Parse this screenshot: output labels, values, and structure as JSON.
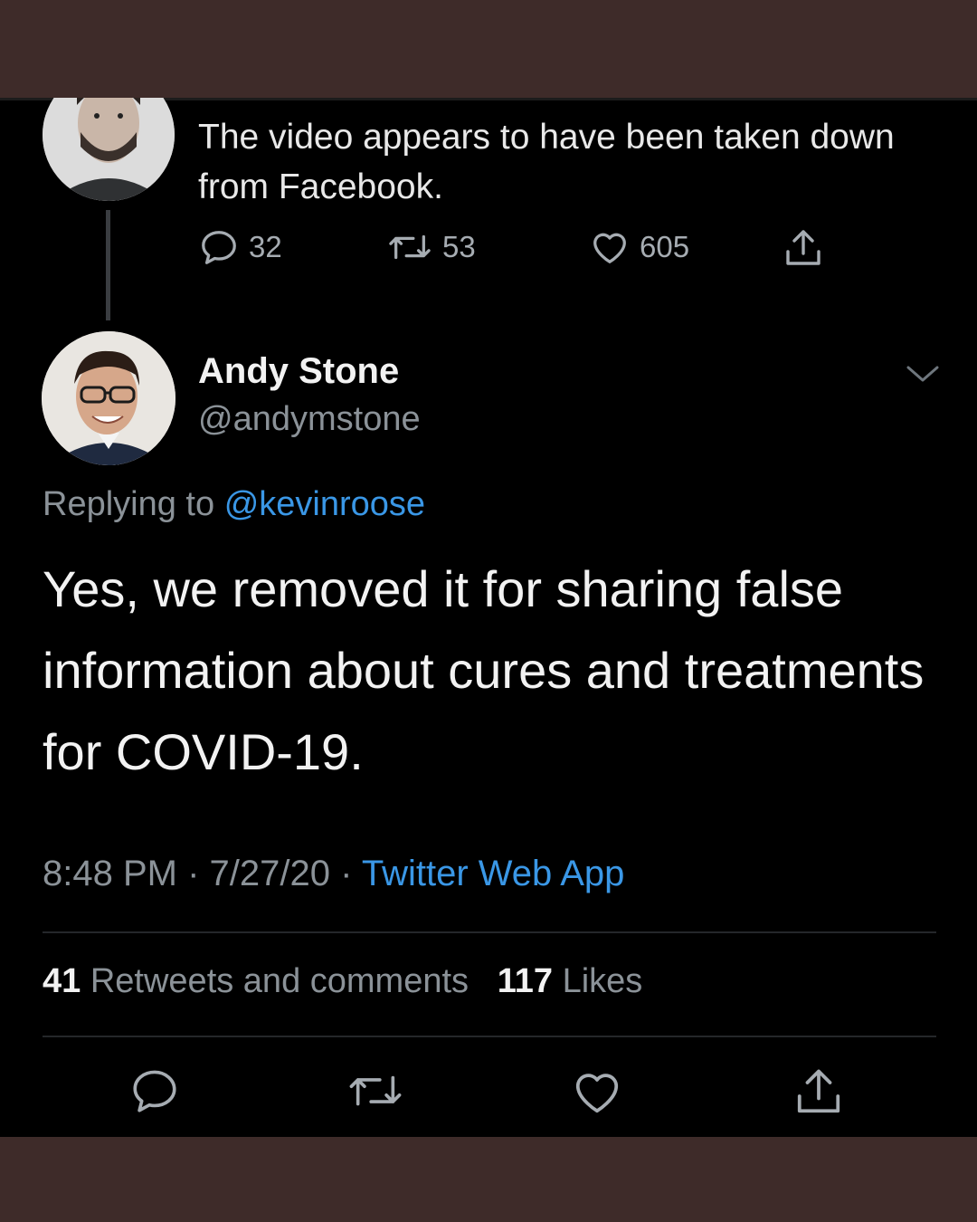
{
  "previous_tweet": {
    "text": "The video appears to have been taken down from Facebook.",
    "actions": {
      "replies": "32",
      "retweets": "53",
      "likes": "605"
    }
  },
  "main_tweet": {
    "author_name": "Andy Stone",
    "handle": "@andymstone",
    "replying_prefix": "Replying to",
    "replying_to": "@kevinroose",
    "text": "Yes, we removed it for sharing false information about cures and treatments for COVID-19.",
    "time": "8:48 PM",
    "date": "7/27/20",
    "separator": "·",
    "source": "Twitter Web App",
    "retweets_count": "41",
    "retweets_label": "Retweets and comments",
    "likes_count": "117",
    "likes_label": "Likes"
  },
  "icons": {
    "reply": "reply-icon",
    "retweet": "retweet-icon",
    "like": "heart-icon",
    "share": "share-icon",
    "more": "chevron-down-icon"
  },
  "colors": {
    "background": "#000000",
    "frame": "#3e2b29",
    "link": "#3a97e6",
    "text": "#f2f2f2",
    "muted": "#8b9298"
  }
}
